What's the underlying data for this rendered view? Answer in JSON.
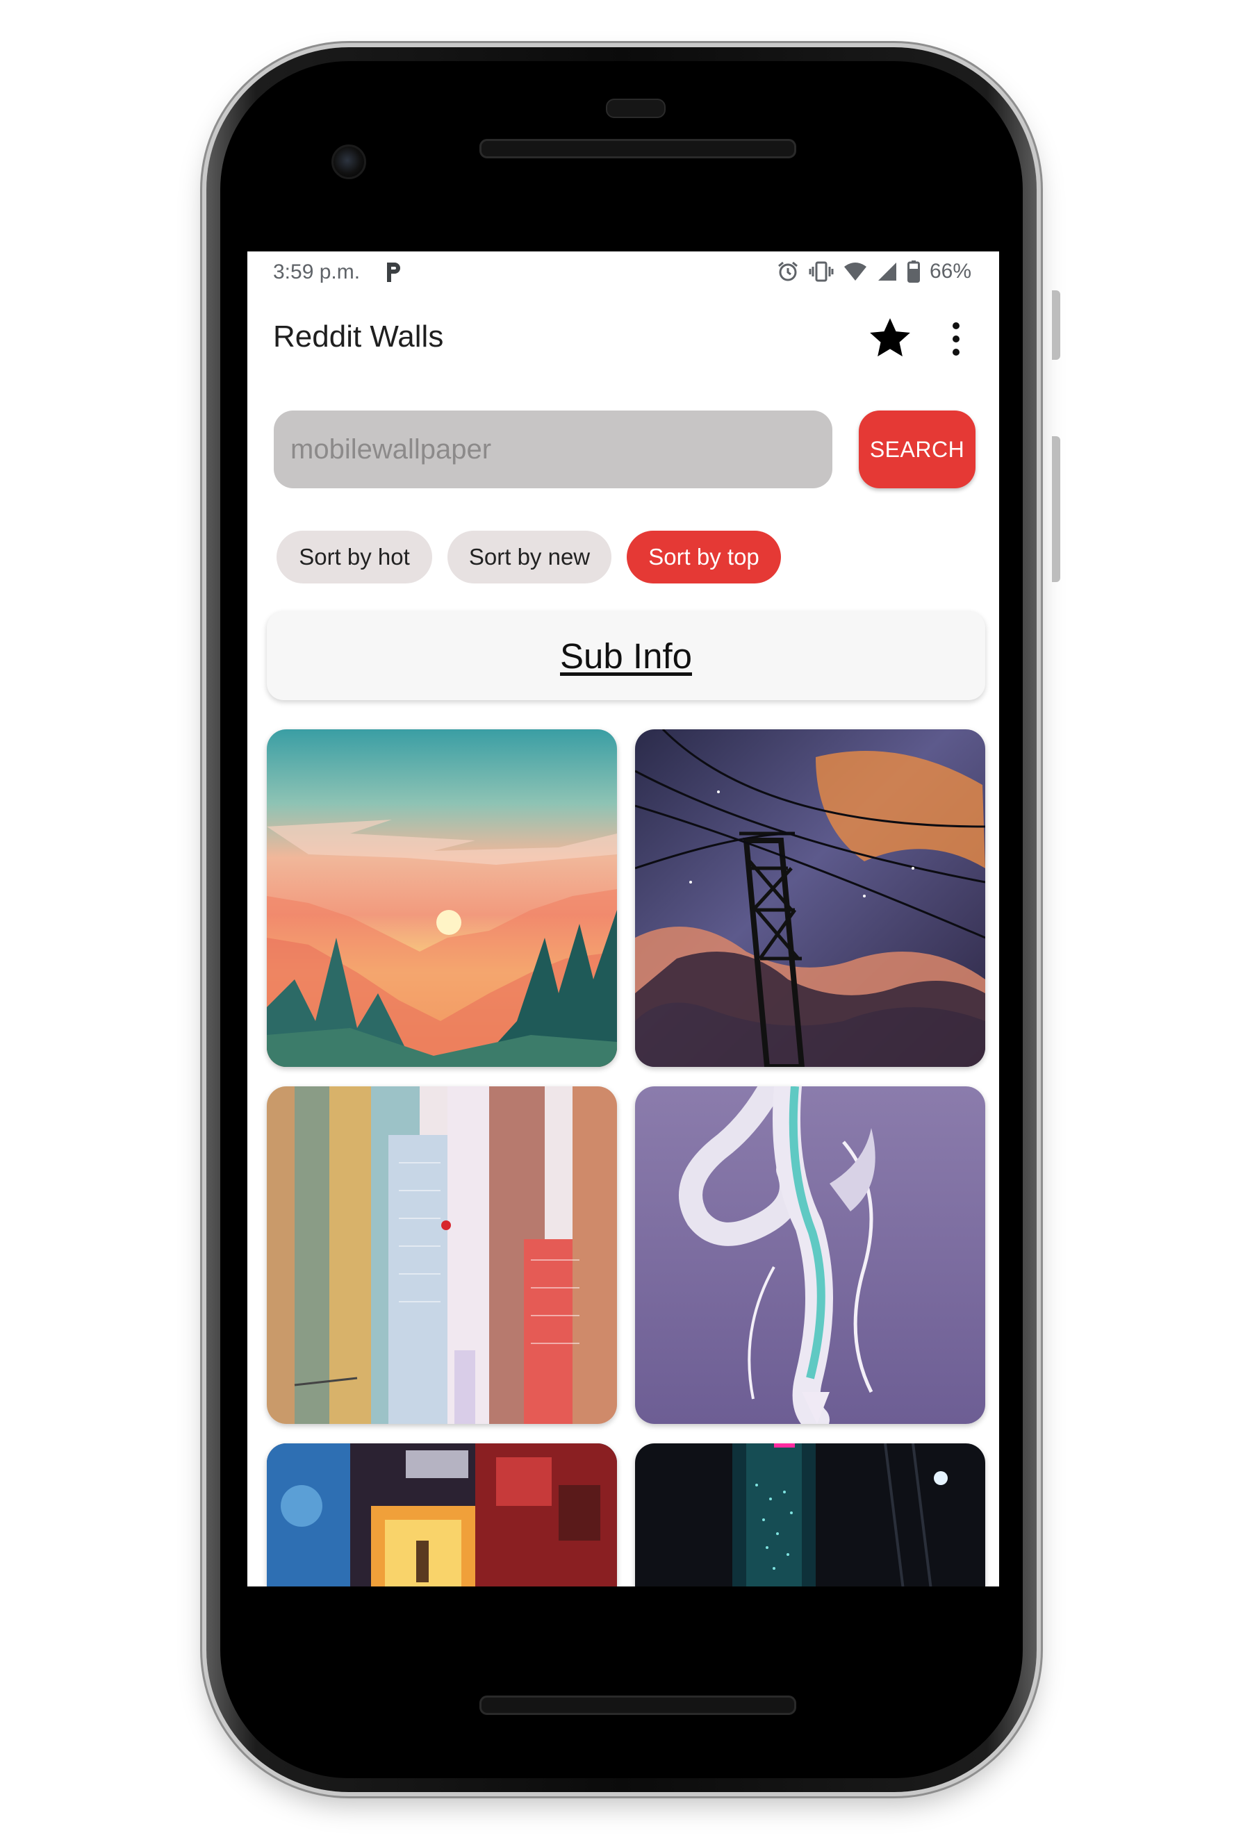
{
  "status_bar": {
    "time": "3:59 p.m.",
    "battery": "66%",
    "icons": [
      "parking-icon",
      "alarm-icon",
      "vibrate-icon",
      "wifi-icon",
      "signal-icon",
      "battery-icon"
    ]
  },
  "app": {
    "title": "Reddit Walls",
    "actions": [
      "star-icon",
      "more-vert-icon"
    ]
  },
  "search": {
    "placeholder": "mobilewallpaper",
    "button_label": "SEARCH"
  },
  "sort_chips": [
    {
      "label": "Sort by hot",
      "active": false
    },
    {
      "label": "Sort by new",
      "active": false
    },
    {
      "label": "Sort by top",
      "active": true
    }
  ],
  "sub_info": {
    "label": "Sub Info"
  },
  "wallpapers": [
    {
      "name": "forest-sunset-wallpaper"
    },
    {
      "name": "power-lines-sky-wallpaper"
    },
    {
      "name": "city-buildings-wallpaper"
    },
    {
      "name": "white-dragon-wallpaper"
    },
    {
      "name": "neon-room-wallpaper"
    },
    {
      "name": "dark-alley-wallpaper"
    }
  ],
  "colors": {
    "accent": "#e53935",
    "chip_inactive": "#e7e1e1",
    "search_field": "#c7c5c5",
    "card": "#f7f7f7"
  }
}
